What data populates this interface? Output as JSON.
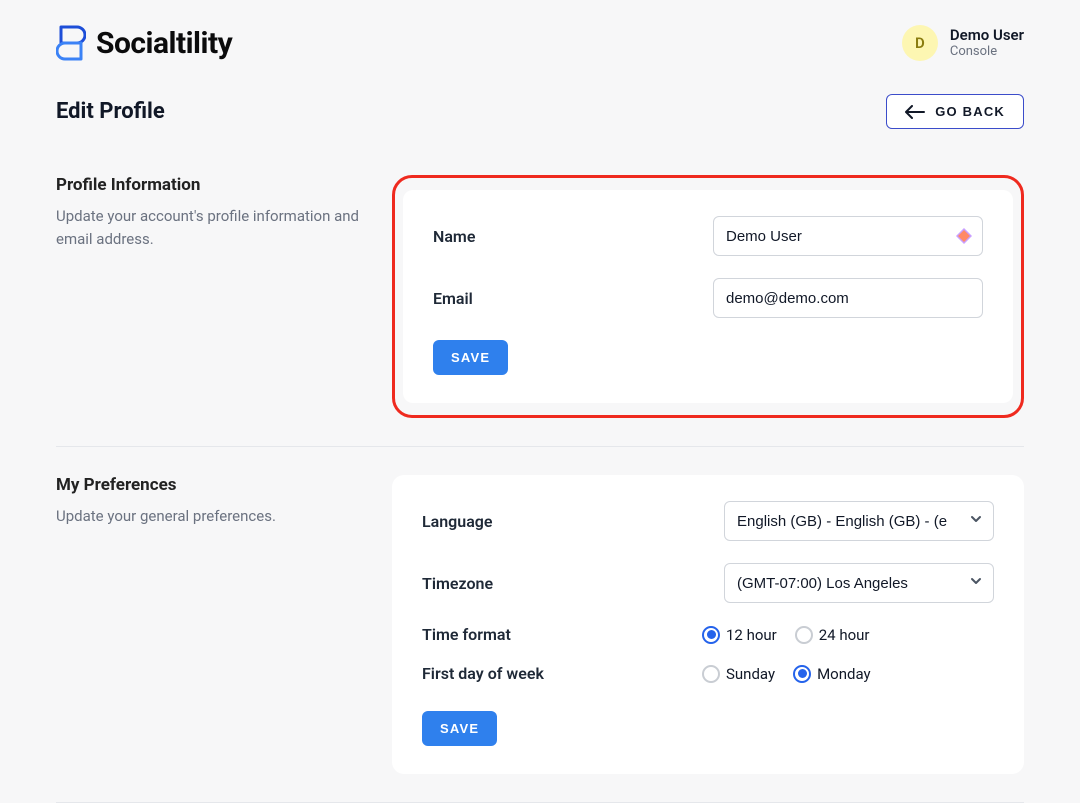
{
  "brand": {
    "name": "Socialtility"
  },
  "user": {
    "initial": "D",
    "name": "Demo User",
    "role": "Console"
  },
  "page": {
    "title": "Edit Profile",
    "go_back": "GO BACK"
  },
  "profile_section": {
    "heading": "Profile Information",
    "description": "Update your account's profile information and email address.",
    "fields": {
      "name_label": "Name",
      "name_value": "Demo User",
      "email_label": "Email",
      "email_value": "demo@demo.com"
    },
    "save_label": "SAVE"
  },
  "prefs_section": {
    "heading": "My Preferences",
    "description": "Update your general preferences.",
    "fields": {
      "language_label": "Language",
      "language_value": "English (GB) - English (GB) - (e",
      "timezone_label": "Timezone",
      "timezone_value": "(GMT-07:00) Los Angeles",
      "timeformat_label": "Time format",
      "timeformat_options": {
        "h12": "12 hour",
        "h24": "24 hour"
      },
      "timeformat_selected": "h12",
      "firstday_label": "First day of week",
      "firstday_options": {
        "sun": "Sunday",
        "mon": "Monday"
      },
      "firstday_selected": "mon"
    },
    "save_label": "SAVE"
  }
}
